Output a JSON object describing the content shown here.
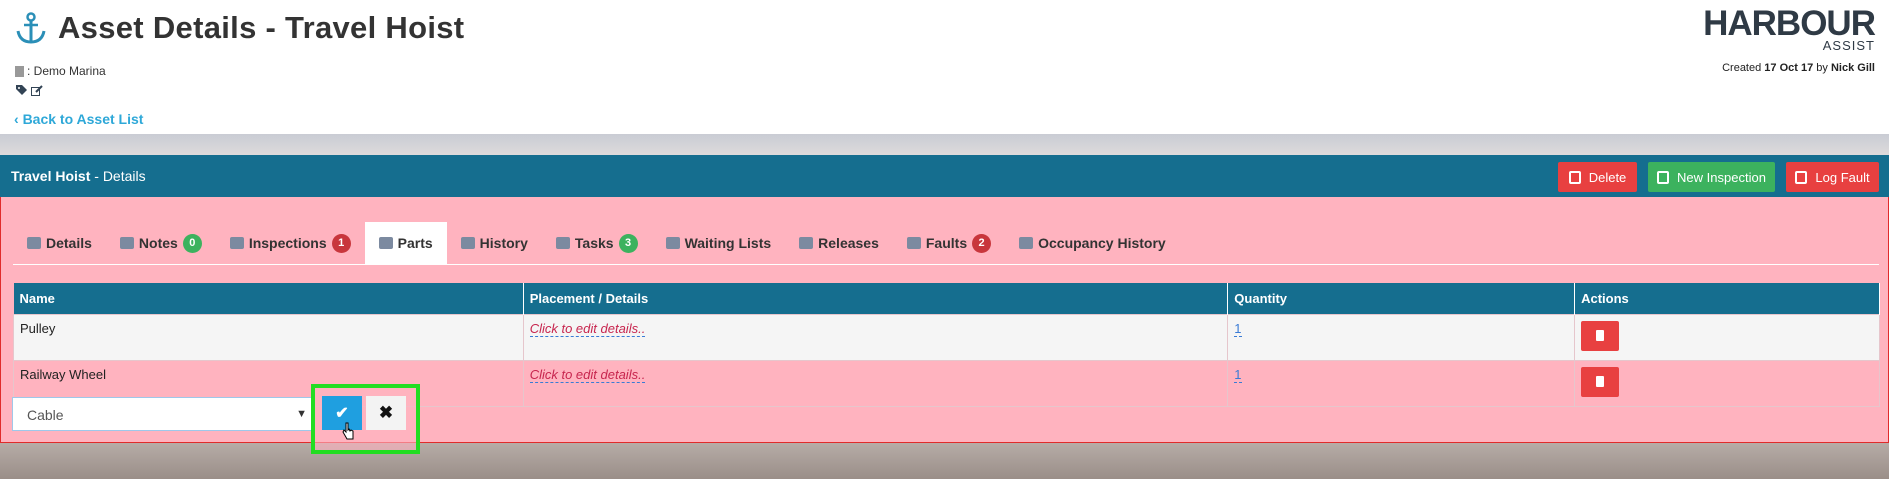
{
  "header": {
    "title": "Asset Details - Travel Hoist",
    "marina": ": Demo Marina",
    "back_link": "Back to Asset List",
    "logo_main": "HARBOUR",
    "logo_sub": "ASSIST",
    "created_prefix": "Created",
    "created_date": "17 Oct 17",
    "created_by_word": "by",
    "created_by": "Nick Gill"
  },
  "panel": {
    "title": "Travel Hoist",
    "subtitle": " - Details",
    "buttons": {
      "delete": "Delete",
      "new_inspection": "New Inspection",
      "log_fault": "Log Fault"
    }
  },
  "tabs": [
    {
      "label": "Details",
      "icon": "anchor-icon"
    },
    {
      "label": "Notes",
      "icon": "note-icon",
      "badge": "0"
    },
    {
      "label": "Inspections",
      "icon": "alarm-icon",
      "badge": "1"
    },
    {
      "label": "Parts",
      "icon": "puzzle-icon",
      "active": true
    },
    {
      "label": "History",
      "icon": "history-icon"
    },
    {
      "label": "Tasks",
      "icon": "tasks-icon",
      "badge": "3"
    },
    {
      "label": "Waiting Lists",
      "icon": "clock-icon"
    },
    {
      "label": "Releases",
      "icon": "sign-out-icon"
    },
    {
      "label": "Faults",
      "icon": "car-icon",
      "badge": "2"
    },
    {
      "label": "Occupancy History",
      "icon": "bed-icon"
    }
  ],
  "table": {
    "headers": [
      "Name",
      "Placement / Details",
      "Quantity",
      "Actions"
    ],
    "rows": [
      {
        "name": "Pulley",
        "details": "Click to edit details..",
        "quantity": "1"
      },
      {
        "name": "Railway Wheel",
        "details": "Click to edit details..",
        "quantity": "1"
      }
    ]
  },
  "add_part": {
    "selected": "Cable"
  },
  "colors": {
    "header_bar": "#156e8f",
    "panel_bg": "#ffb3bf",
    "danger": "#e84040",
    "success": "#3cb25e",
    "confirm": "#1f9fe0",
    "highlight": "#22dd22"
  }
}
